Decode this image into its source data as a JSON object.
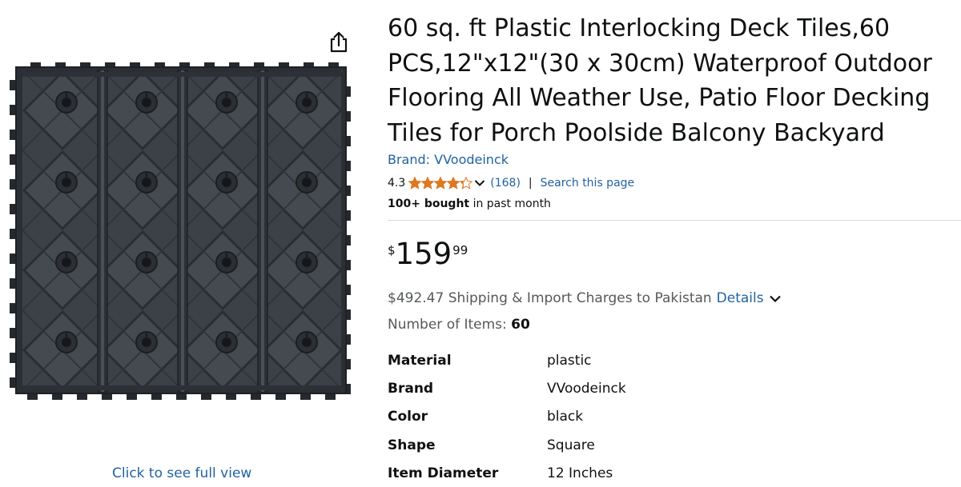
{
  "product": {
    "title": "60 sq. ft Plastic Interlocking Deck Tiles,60 PCS,12\"x12\"(30 x 30cm) Waterproof Outdoor Flooring All Weather Use, Patio Floor Decking Tiles for Porch Poolside Balcony Backyard",
    "brand_link": "Brand: VVoodeinck",
    "rating": {
      "value": "4.3",
      "stars_out_of_5": 4.3,
      "count": "(168)",
      "separator": "|",
      "search_link": "Search this page"
    },
    "bought": {
      "bold": "100+ bought",
      "rest": " in past month"
    },
    "price": {
      "symbol": "$",
      "whole": "159",
      "fraction": "99"
    },
    "shipping": {
      "text": "$492.47 Shipping & Import Charges to Pakistan",
      "details_link": "Details"
    },
    "number_of_items": {
      "label": "Number of Items: ",
      "value": "60"
    },
    "specs": [
      {
        "key": "Material",
        "value": "plastic"
      },
      {
        "key": "Brand",
        "value": "VVoodeinck"
      },
      {
        "key": "Color",
        "value": "black"
      },
      {
        "key": "Shape",
        "value": "Square"
      },
      {
        "key": "Item Diameter",
        "value": "12 Inches"
      }
    ]
  },
  "image_panel": {
    "full_view_link": "Click to see full view",
    "share_icon": "share-icon"
  },
  "colors": {
    "link": "#2162a1",
    "star": "#de7921",
    "text": "#0f1111",
    "secondary_text": "#565959",
    "divider": "#d5d9d9"
  }
}
